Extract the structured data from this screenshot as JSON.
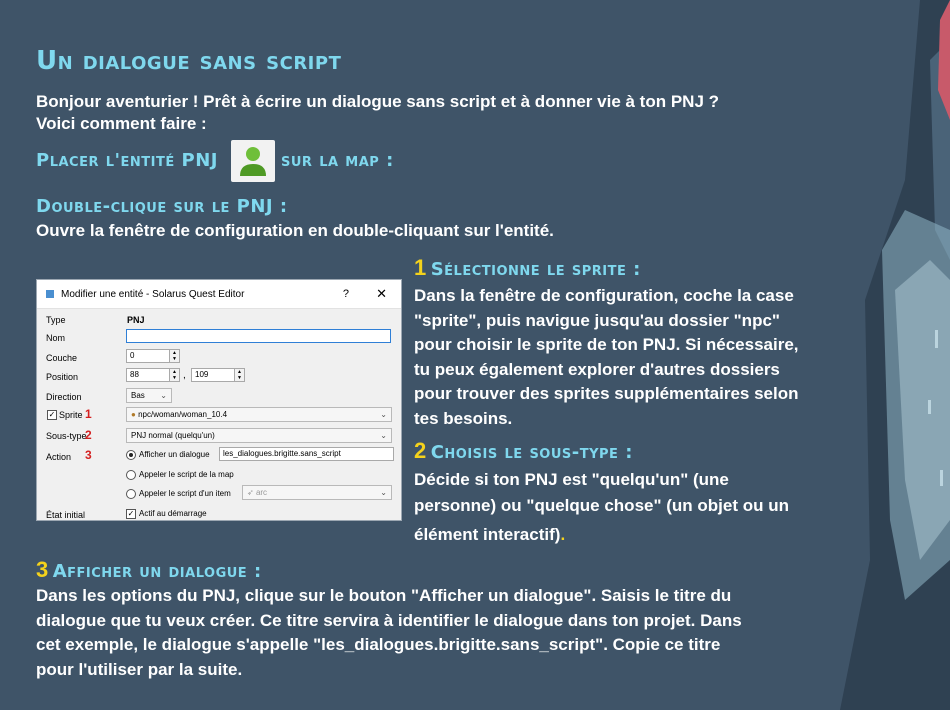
{
  "title": "Un dialogue sans script",
  "intro_line1": "Bonjour aventurier ! Prêt à écrire un dialogue sans script et à donner vie à ton PNJ ?",
  "intro_line2": "Voici comment faire :",
  "step_place": {
    "before": "Placer l'entité PNJ",
    "after": "sur la map :",
    "icon": "npc-person-icon"
  },
  "step_double": {
    "heading": "Double-clique sur le PNJ :",
    "text": "Ouvre la fenêtre de configuration en double-cliquant sur l'entité."
  },
  "step1": {
    "num": "1",
    "heading": "Sélectionne le sprite :",
    "lines": [
      "Dans la fenêtre de configuration, coche la case",
      "\"sprite\", puis navigue jusqu'au dossier \"npc\"",
      "pour choisir le sprite de ton PNJ. Si nécessaire,",
      "tu peux également explorer d'autres dossiers",
      "pour trouver des sprites supplémentaires selon",
      "tes besoins."
    ]
  },
  "step2": {
    "num": "2",
    "heading": "Choisis le sous-type :",
    "lines": [
      "Décide si ton PNJ est \"quelqu'un\" (une",
      "personne) ou \"quelque chose\" (un objet ou un",
      "élément interactif)"
    ],
    "end_dot": "."
  },
  "step3": {
    "num": "3",
    "heading": "Afficher un dialogue :",
    "lines": [
      "Dans les options du PNJ, clique sur le bouton \"Afficher un dialogue\". Saisis le titre du",
      "dialogue que tu veux créer. Ce titre servira à identifier le dialogue dans ton projet. Dans",
      "cet exemple, le dialogue s'appelle \"les_dialogues.brigitte.sans_script\". Copie ce titre",
      "pour l'utiliser par la suite."
    ]
  },
  "editor": {
    "window_title": "Modifier une entité - Solarus Quest Editor",
    "help": "?",
    "close": "✕",
    "type_label": "Type",
    "type_value": "PNJ",
    "name_label": "Nom",
    "name_value": "",
    "layer_label": "Couche",
    "layer_value": "0",
    "position_label": "Position",
    "pos_x": "88",
    "pos_sep": ",",
    "pos_y": "109",
    "direction_label": "Direction",
    "direction_value": "Bas",
    "sprite_label": "Sprite",
    "sprite_checked": true,
    "sprite_value": "npc/woman/woman_10.4",
    "subtype_label": "Sous-type",
    "subtype_value": "PNJ normal (quelqu'un)",
    "action_label": "Action",
    "action_dialog_label": "Afficher un dialogue",
    "action_dialog_value": "les_dialogues.brigitte.sans_script",
    "action_map_label": "Appeler le script de la map",
    "action_item_label": "Appeler le script d'un item",
    "action_item_value": "arc",
    "initial_state_label": "État initial",
    "initial_state_value": "Actif au démarrage",
    "markers": [
      "1",
      "2",
      "3"
    ]
  },
  "colors": {
    "heading": "#7fd8ee",
    "number": "#f4d21c",
    "background": "#3f5468",
    "marker": "#d42020"
  }
}
